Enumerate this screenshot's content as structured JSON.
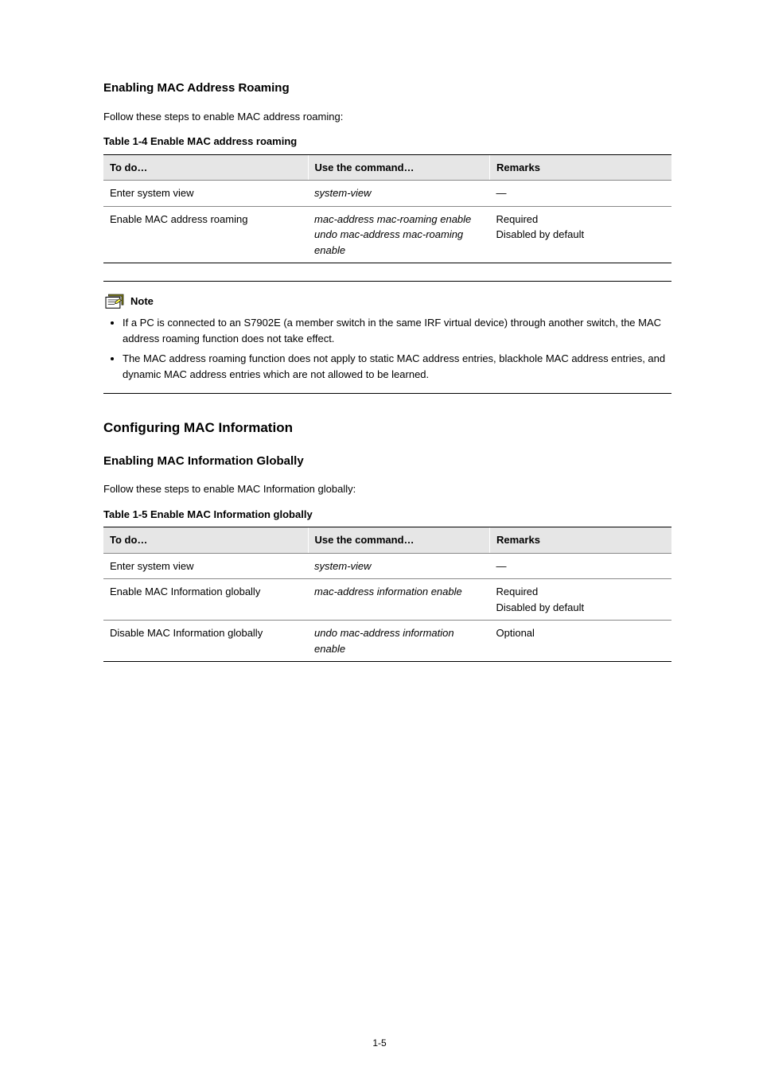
{
  "section1": {
    "heading": "Enabling MAC Address Roaming",
    "intro": "Follow these steps to enable MAC address roaming:",
    "caption": "Table 1-4 Enable MAC address roaming",
    "headers": [
      "To do…",
      "Use the command…",
      "Remarks"
    ],
    "rows": [
      {
        "c1": "Enter system view",
        "c2": "system-view",
        "c3": "—"
      },
      {
        "c1": "Enable MAC address roaming",
        "c2_a": "mac-address mac-roaming enable",
        "c2_b": "undo mac-address mac-roaming enable",
        "c3": "Required\nDisabled by default"
      }
    ]
  },
  "note": {
    "label": "Note",
    "items": [
      "If a PC is connected to an S7902E (a member switch in the same IRF virtual device) through another switch, the MAC address roaming function does not take effect.",
      "The MAC address roaming function does not apply to static MAC address entries, blackhole MAC address entries, and dynamic MAC address entries which are not allowed to be learned."
    ]
  },
  "section2": {
    "heading": "Configuring MAC Information",
    "subheading": "Enabling MAC Information Globally",
    "intro": "Follow these steps to enable MAC Information globally:",
    "caption": "Table 1-5 Enable MAC Information globally",
    "headers": [
      "To do…",
      "Use the command…",
      "Remarks"
    ],
    "rows": [
      {
        "c1": "Enter system view",
        "c2": "system-view",
        "c3": "—"
      },
      {
        "c1": "Enable MAC Information globally",
        "c2": "mac-address information enable",
        "c3": "Required\nDisabled by default"
      },
      {
        "c1": "Disable MAC Information globally",
        "c2": "undo mac-address information enable",
        "c3": "Optional"
      }
    ]
  },
  "page_number": "1-5"
}
